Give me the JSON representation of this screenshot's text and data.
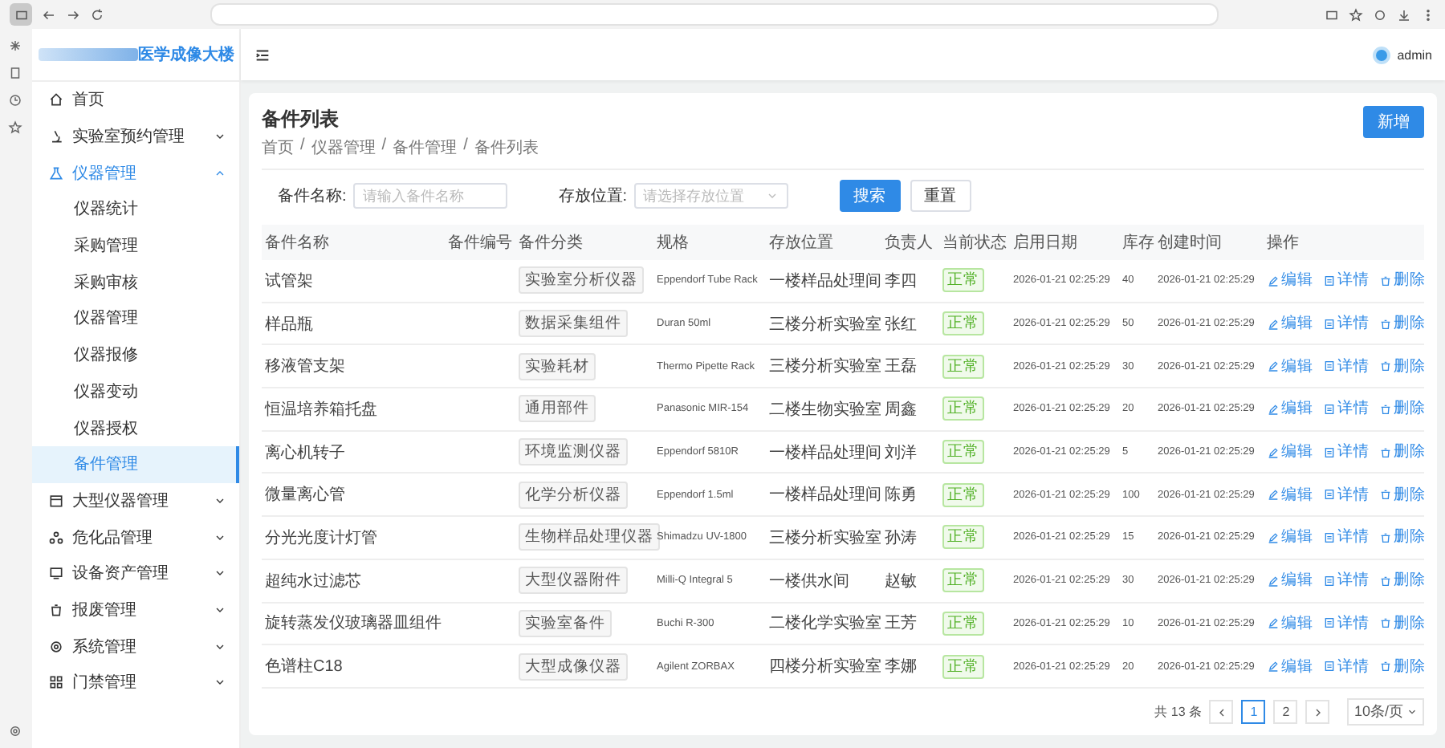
{
  "sidebar": {
    "logo_text": "医学成像大楼",
    "items": [
      {
        "label": "首页",
        "selected": false
      },
      {
        "label": "实验室预约管理",
        "selected": false,
        "expanded": false
      },
      {
        "label": "仪器管理",
        "selected": true,
        "expanded": true,
        "children": [
          {
            "label": "仪器统计",
            "selected": false
          },
          {
            "label": "采购管理",
            "selected": false
          },
          {
            "label": "采购审核",
            "selected": false
          },
          {
            "label": "仪器管理",
            "selected": false
          },
          {
            "label": "仪器报修",
            "selected": false
          },
          {
            "label": "仪器变动",
            "selected": false
          },
          {
            "label": "仪器授权",
            "selected": false
          },
          {
            "label": "备件管理",
            "selected": true
          }
        ]
      },
      {
        "label": "大型仪器管理",
        "selected": false,
        "expanded": false
      },
      {
        "label": "危化品管理",
        "selected": false,
        "expanded": false
      },
      {
        "label": "设备资产管理",
        "selected": false,
        "expanded": false
      },
      {
        "label": "报废管理",
        "selected": false,
        "expanded": false
      },
      {
        "label": "系统管理",
        "selected": false,
        "expanded": false
      },
      {
        "label": "门禁管理",
        "selected": false,
        "expanded": false
      }
    ]
  },
  "header": {
    "user": "admin"
  },
  "page": {
    "title": "备件列表",
    "breadcrumb": [
      "首页",
      "仪器管理",
      "备件管理",
      "备件列表"
    ],
    "breadcrumb_separator": "/",
    "add_button": "新增"
  },
  "filters": [
    {
      "kind": "input",
      "label": "备件名称:",
      "placeholder": "请输入备件名称"
    },
    {
      "kind": "select",
      "label": "存放位置:",
      "placeholder": "请选择存放位置"
    }
  ],
  "filter_buttons": [
    {
      "kind": "primary",
      "label": "搜索"
    },
    {
      "kind": "default",
      "label": "重置"
    }
  ],
  "table": {
    "columns": [
      "备件名称",
      "备件编号",
      "备件分类",
      "规格",
      "存放位置",
      "负责人",
      "当前状态",
      "启用日期",
      "库存",
      "创建时间",
      "操作"
    ],
    "rows": [
      {
        "name": "试管架",
        "category": "实验室分析仪器",
        "spec": "Eppendorf Tube Rack",
        "location": "一楼样品处理间",
        "person": "李四",
        "status": "正常",
        "enabled": "2026-01-21 02:25:29",
        "stock": "40",
        "created": "2026-01-21 02:25:29",
        "actions": [
          "编辑",
          "详情",
          "删除"
        ]
      },
      {
        "name": "样品瓶",
        "category": "数据采集组件",
        "spec": "Duran 50ml",
        "location": "三楼分析实验室",
        "person": "张红",
        "status": "正常",
        "enabled": "2026-01-21 02:25:29",
        "stock": "50",
        "created": "2026-01-21 02:25:29",
        "actions": [
          "编辑",
          "详情",
          "删除"
        ]
      },
      {
        "name": "移液管支架",
        "category": "实验耗材",
        "spec": "Thermo Pipette Rack",
        "location": "三楼分析实验室",
        "person": "王磊",
        "status": "正常",
        "enabled": "2026-01-21 02:25:29",
        "stock": "30",
        "created": "2026-01-21 02:25:29",
        "actions": [
          "编辑",
          "详情",
          "删除"
        ]
      },
      {
        "name": "恒温培养箱托盘",
        "category": "通用部件",
        "spec": "Panasonic MIR-154",
        "location": "二楼生物实验室",
        "person": "周鑫",
        "status": "正常",
        "enabled": "2026-01-21 02:25:29",
        "stock": "20",
        "created": "2026-01-21 02:25:29",
        "actions": [
          "编辑",
          "详情",
          "删除"
        ]
      },
      {
        "name": "离心机转子",
        "category": "环境监测仪器",
        "spec": "Eppendorf 5810R",
        "location": "一楼样品处理间",
        "person": "刘洋",
        "status": "正常",
        "enabled": "2026-01-21 02:25:29",
        "stock": "5",
        "created": "2026-01-21 02:25:29",
        "actions": [
          "编辑",
          "详情",
          "删除"
        ]
      },
      {
        "name": "微量离心管",
        "category": "化学分析仪器",
        "spec": "Eppendorf 1.5ml",
        "location": "一楼样品处理间",
        "person": "陈勇",
        "status": "正常",
        "enabled": "2026-01-21 02:25:29",
        "stock": "100",
        "created": "2026-01-21 02:25:29",
        "actions": [
          "编辑",
          "详情",
          "删除"
        ]
      },
      {
        "name": "分光光度计灯管",
        "category": "生物样品处理仪器",
        "spec": "Shimadzu UV-1800",
        "location": "三楼分析实验室",
        "person": "孙涛",
        "status": "正常",
        "enabled": "2026-01-21 02:25:29",
        "stock": "15",
        "created": "2026-01-21 02:25:29",
        "actions": [
          "编辑",
          "详情",
          "删除"
        ]
      },
      {
        "name": "超纯水过滤芯",
        "category": "大型仪器附件",
        "spec": "Milli-Q Integral 5",
        "location": "一楼供水间",
        "person": "赵敏",
        "status": "正常",
        "enabled": "2026-01-21 02:25:29",
        "stock": "30",
        "created": "2026-01-21 02:25:29",
        "actions": [
          "编辑",
          "详情",
          "删除"
        ]
      },
      {
        "name": "旋转蒸发仪玻璃器皿组件",
        "category": "实验室备件",
        "spec": "Buchi R-300",
        "location": "二楼化学实验室",
        "person": "王芳",
        "status": "正常",
        "enabled": "2026-01-21 02:25:29",
        "stock": "10",
        "created": "2026-01-21 02:25:29",
        "actions": [
          "编辑",
          "详情",
          "删除"
        ]
      },
      {
        "name": "色谱柱C18",
        "category": "大型成像仪器",
        "spec": "Agilent ZORBAX",
        "location": "四楼分析实验室",
        "person": "李娜",
        "status": "正常",
        "enabled": "2026-01-21 02:25:29",
        "stock": "20",
        "created": "2026-01-21 02:25:29",
        "actions": [
          "编辑",
          "详情",
          "删除"
        ]
      }
    ]
  },
  "pagination": {
    "total": "共 13 条",
    "pages": [
      {
        "label": "1",
        "selected": true
      },
      {
        "label": "2",
        "selected": false
      }
    ],
    "page_size": "10条/页"
  }
}
